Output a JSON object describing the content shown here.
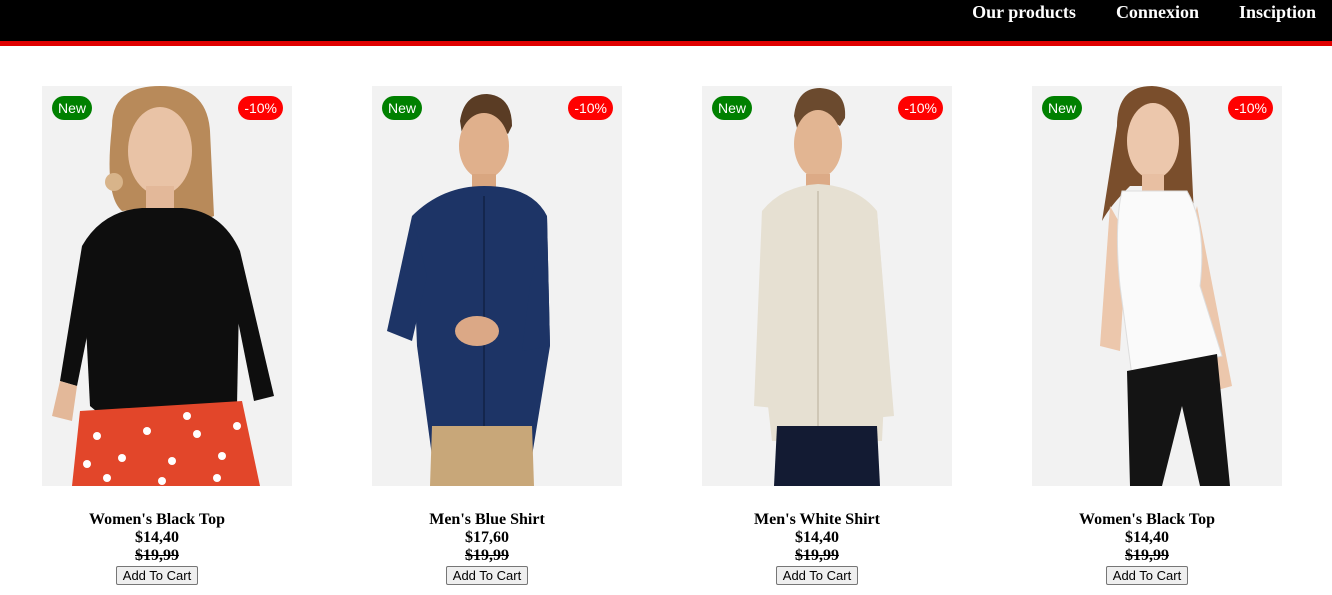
{
  "nav": {
    "items": [
      "Our products",
      "Connexion",
      "Insciption"
    ]
  },
  "colors": {
    "topbar": "#000000",
    "accent_line": "#e00000",
    "badge_new": "#008000",
    "badge_sale": "#ff0000"
  },
  "products": [
    {
      "name": "Women's Black Top",
      "price": "$14,40",
      "old_price": "$19,99",
      "badge_new": "New",
      "badge_discount": "-10%",
      "button": "Add To Cart"
    },
    {
      "name": "Men's Blue Shirt",
      "price": "$17,60",
      "old_price": "$19,99",
      "badge_new": "New",
      "badge_discount": "-10%",
      "button": "Add To Cart"
    },
    {
      "name": "Men's White Shirt",
      "price": "$14,40",
      "old_price": "$19,99",
      "badge_new": "New",
      "badge_discount": "-10%",
      "button": "Add To Cart"
    },
    {
      "name": "Women's Black Top",
      "price": "$14,40",
      "old_price": "$19,99",
      "badge_new": "New",
      "badge_discount": "-10%",
      "button": "Add To Cart"
    }
  ]
}
